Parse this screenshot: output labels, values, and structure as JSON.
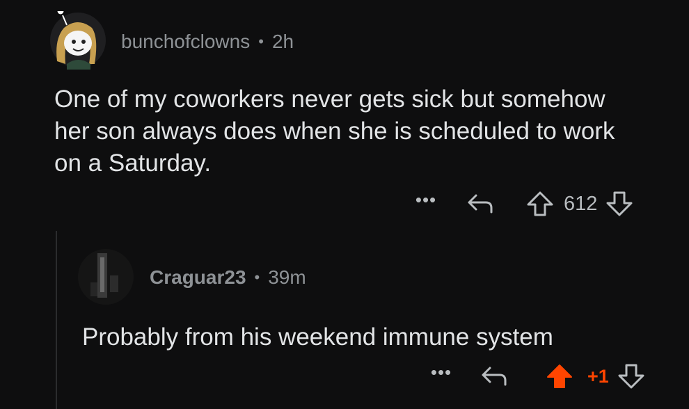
{
  "comment": {
    "author": "bunchofclowns",
    "separator": "•",
    "age": "2h",
    "text": "One of my coworkers never gets sick but somehow her son always does when she is scheduled to work on a Saturday.",
    "more_label": "•••",
    "score": "612",
    "icons": [
      "more-icon",
      "reply-icon",
      "upvote-icon",
      "downvote-icon"
    ]
  },
  "reply": {
    "author": "Craguar23",
    "separator": "•",
    "age": "39m",
    "text": "Probably from his weekend immune system",
    "more_label": "•••",
    "score": "+1",
    "upvoted": true,
    "icons": [
      "more-icon",
      "reply-icon",
      "upvote-icon",
      "downvote-icon"
    ]
  },
  "colors": {
    "background": "#0e0e0f",
    "text": "#e2e4e6",
    "meta": "#8e9296",
    "upvote_active": "#ff4500"
  }
}
